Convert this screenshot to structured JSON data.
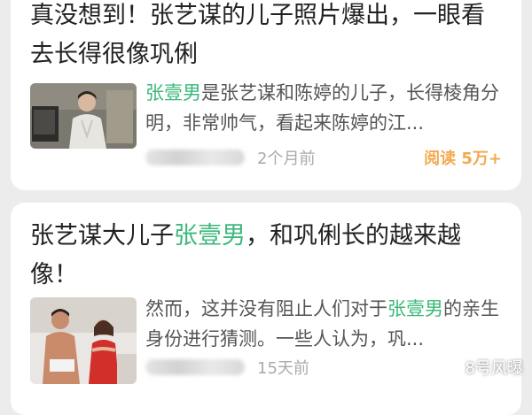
{
  "articles": [
    {
      "title": "真没想到！张艺谋的儿子照片爆出，一眼看去长得很像巩俐",
      "summary_highlight": "张壹男",
      "summary_rest": "是张艺谋和陈婷的儿子，长得棱角分明，非常帅气，看起来陈婷的江...",
      "time": "2个月前",
      "reads": "阅读 5万+"
    },
    {
      "title_prefix": "张艺谋大儿子",
      "title_highlight": "张壹男",
      "title_suffix": "，和巩俐长的越来越像！",
      "summary_prefix": "然而，这并没有阻止人们对于",
      "summary_highlight": "张壹男",
      "summary_rest": "的亲生身份进行猜测。一些人认为，巩...",
      "time": "15天前"
    }
  ],
  "watermark": {
    "text": "8号风曝",
    "icon": "wechat-channel-icon"
  },
  "colors": {
    "highlight": "#3bb87a",
    "reads": "#f3a94f",
    "meta": "#aaaaaa"
  }
}
